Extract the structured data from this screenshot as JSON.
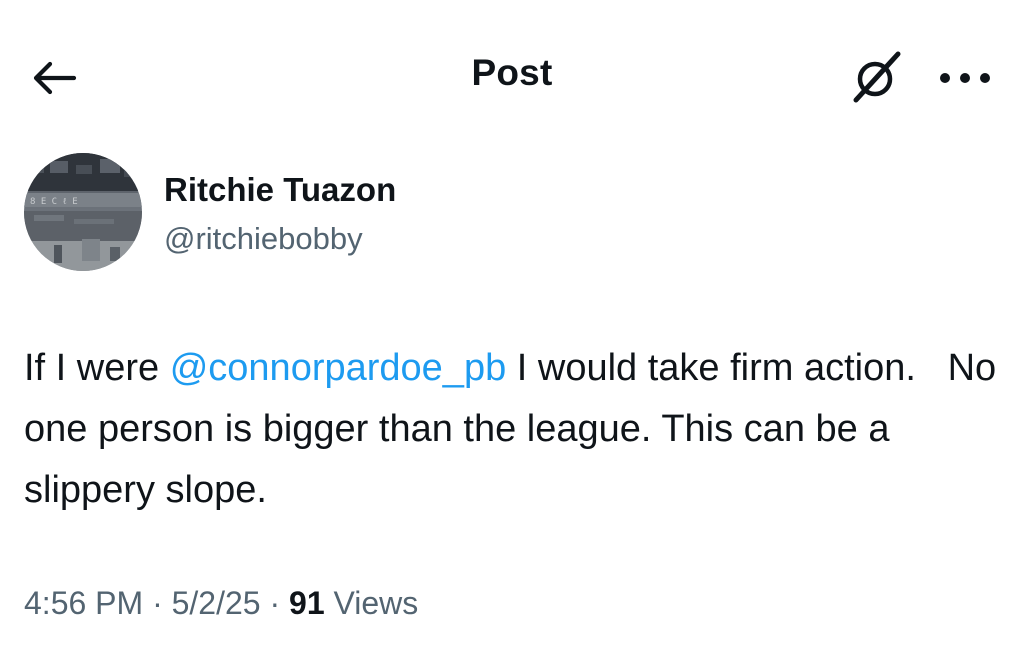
{
  "header": {
    "title": "Post",
    "back_icon": "arrow-left-icon",
    "grok_icon": "grok-icon",
    "more_icon": "more-horizontal-icon"
  },
  "author": {
    "display_name": "Ritchie Tuazon",
    "handle": "@ritchiebobby",
    "avatar_icon": "avatar-photo"
  },
  "tweet": {
    "text_before": "If I were ",
    "mention": "@connorpardoe_pb",
    "text_after": " I would take firm action.   No one person is bigger than the league. This can be a slippery slope."
  },
  "meta": {
    "time": "4:56 PM",
    "date": "5/2/25",
    "separator": " · ",
    "views_count": "91",
    "views_label": " Views"
  },
  "colors": {
    "text": "#0f1419",
    "secondary": "#536471",
    "accent": "#1d9bf0"
  }
}
